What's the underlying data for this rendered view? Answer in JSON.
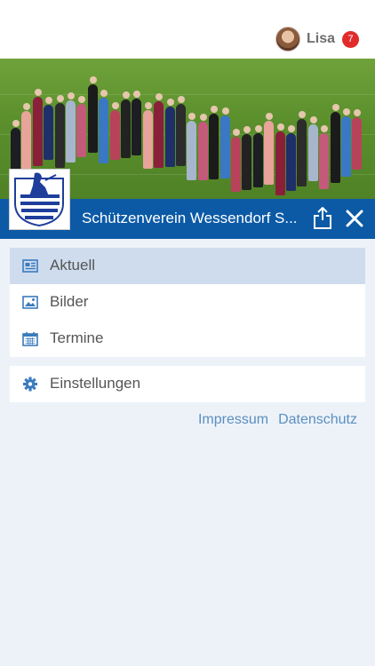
{
  "header": {
    "user_name": "Lisa",
    "notification_count": "7"
  },
  "club": {
    "name": "Schützenverein Wessendorf S..."
  },
  "menu": {
    "items": [
      {
        "label": "Aktuell",
        "icon": "newspaper-icon",
        "active": true
      },
      {
        "label": "Bilder",
        "icon": "image-icon",
        "active": false
      },
      {
        "label": "Termine",
        "icon": "calendar-icon",
        "active": false
      }
    ],
    "settings": {
      "label": "Einstellungen",
      "icon": "gear-icon"
    }
  },
  "footer": {
    "impressum": "Impressum",
    "datenschutz": "Datenschutz"
  },
  "colors": {
    "brand_blue": "#0c5aa6",
    "badge_red": "#e12b2b",
    "active_item": "#cfdcee",
    "link": "#5b8fbf",
    "background": "#edf2f9"
  }
}
